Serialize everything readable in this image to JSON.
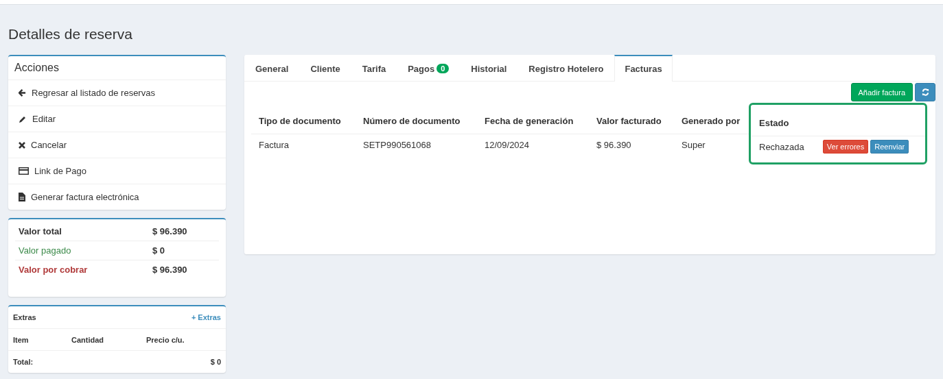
{
  "page_title": "Detalles de reserva",
  "actions": {
    "title": "Acciones",
    "items": [
      {
        "kind": "back",
        "label": "Regresar al listado de reservas"
      },
      {
        "kind": "edit",
        "label": "Editar"
      },
      {
        "kind": "cancel",
        "label": "Cancelar"
      },
      {
        "kind": "card",
        "label": "Link de Pago"
      },
      {
        "kind": "document",
        "label": "Generar factura electrónica"
      }
    ]
  },
  "summary": [
    {
      "label": "Valor total",
      "value": "$ 96.390",
      "color": "#333333",
      "bold": true
    },
    {
      "label": "Valor pagado",
      "value": "$ 0",
      "color": "#3c8a4a",
      "bold": false
    },
    {
      "label": "Valor por cobrar",
      "value": "$ 96.390",
      "color": "#b03a3a",
      "bold": true
    }
  ],
  "extras": {
    "title": "Extras",
    "add_link": "+ Extras",
    "columns": [
      "Item",
      "Cantidad",
      "Precio c/u."
    ],
    "total_label": "Total:",
    "total_value": "$ 0"
  },
  "tabs": [
    {
      "label": "General",
      "selected": false
    },
    {
      "label": "Cliente",
      "selected": false
    },
    {
      "label": "Tarifa",
      "selected": false
    },
    {
      "label": "Pagos",
      "badge": "0",
      "selected": false
    },
    {
      "label": "Historial",
      "selected": false
    },
    {
      "label": "Registro Hotelero",
      "selected": false
    },
    {
      "label": "Facturas",
      "selected": true
    }
  ],
  "toolbar": {
    "add_button": "Añadir factura"
  },
  "table": {
    "columns": [
      {
        "heading": "Tipo de documento",
        "highlighted": false
      },
      {
        "heading": "Número de documento",
        "highlighted": false
      },
      {
        "heading": "Fecha de generación",
        "highlighted": false
      },
      {
        "heading": "Valor facturado",
        "highlighted": false
      },
      {
        "heading": "Generado por",
        "highlighted": false
      },
      {
        "heading": "Estado",
        "highlighted": true
      }
    ],
    "rows": [
      {
        "cells": [
          "Factura",
          "SETP990561068",
          "12/09/2024",
          "$ 96.390",
          "Super",
          "Rechazada"
        ],
        "actions": [
          {
            "label": "Ver errores",
            "kind": "danger"
          },
          {
            "label": "Reenviar",
            "kind": "info"
          }
        ]
      }
    ]
  }
}
